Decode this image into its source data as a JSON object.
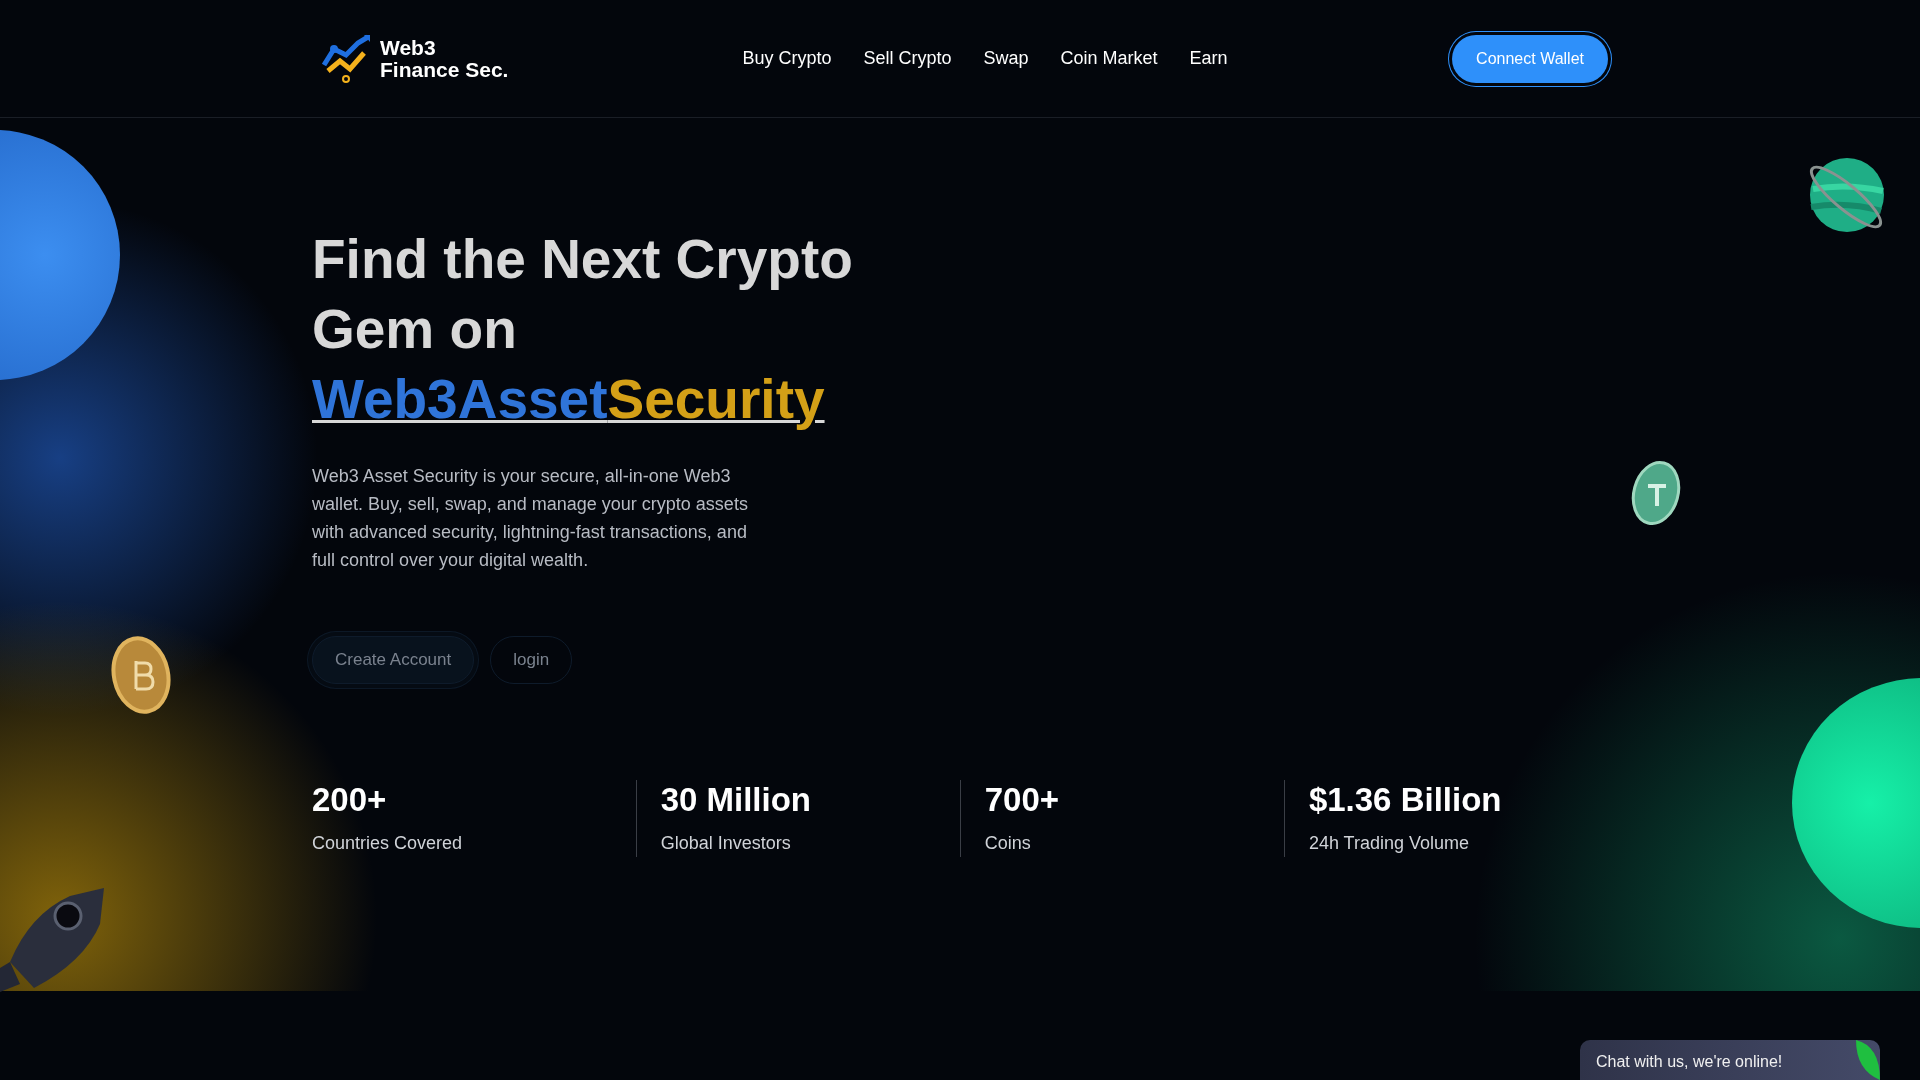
{
  "brand": {
    "line_1": "Web3",
    "line_2": "Finance Sec."
  },
  "nav": [
    {
      "label": "Buy Crypto"
    },
    {
      "label": "Sell Crypto"
    },
    {
      "label": "Swap"
    },
    {
      "label": "Coin Market"
    },
    {
      "label": "Earn"
    }
  ],
  "connect_button": "Connect Wallet",
  "hero": {
    "title_line_1": "Find the Next Crypto",
    "title_line_2": "Gem on",
    "highlight": [
      {
        "text": "Web3Asset",
        "color": "#2f74d9"
      },
      {
        "text": "Security",
        "color": "#d4a017"
      }
    ],
    "description": "Web3 Asset Security is your secure, all-in-one Web3 wallet. Buy, sell, swap, and manage your crypto assets with advanced security, lightning-fast transactions, and full control over your digital wealth.",
    "buttons": [
      {
        "label": "Create Account",
        "kind": "primary"
      },
      {
        "label": "login",
        "kind": "outline"
      }
    ]
  },
  "stats": [
    {
      "value": "200+",
      "label": "Countries Covered"
    },
    {
      "value": "30 Million",
      "label": "Global Investors"
    },
    {
      "value": "700+",
      "label": "Coins"
    },
    {
      "value": "$1.36 Billion",
      "label": "24h Trading Volume"
    }
  ],
  "chat": {
    "text": "Chat with us, we're online!"
  }
}
